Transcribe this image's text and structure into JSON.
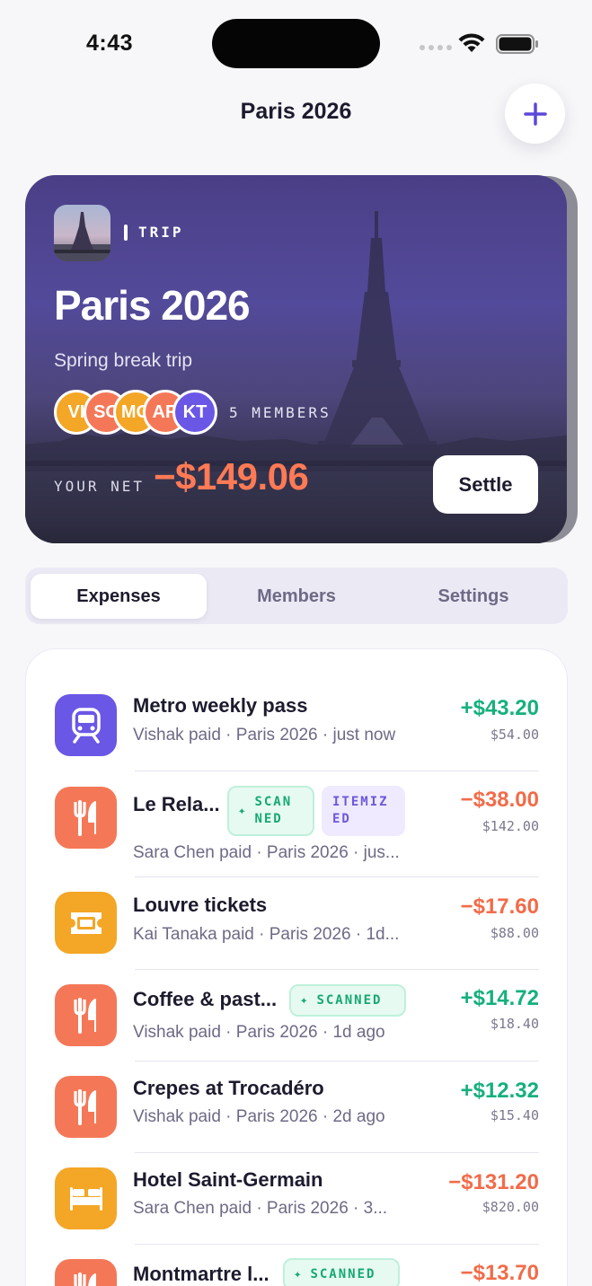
{
  "status_bar": {
    "time": "4:43"
  },
  "nav": {
    "title": "Paris 2026"
  },
  "hero": {
    "kind_label": "TRIP",
    "title": "Paris 2026",
    "subtitle": "Spring break trip",
    "avatars": [
      {
        "initials": "VI",
        "color": "#f4a626"
      },
      {
        "initials": "SC",
        "color": "#f47858"
      },
      {
        "initials": "MO",
        "color": "#f4a626"
      },
      {
        "initials": "AR",
        "color": "#f47858"
      },
      {
        "initials": "KT",
        "color": "#6a57e6"
      }
    ],
    "members_label": "5 MEMBERS",
    "net_label": "YOUR NET",
    "net_value": "−$149.06",
    "settle_label": "Settle"
  },
  "tabs": [
    {
      "label": "Expenses",
      "active": true
    },
    {
      "label": "Members",
      "active": false
    },
    {
      "label": "Settings",
      "active": false
    }
  ],
  "expenses": [
    {
      "icon": "train-icon",
      "icon_color": "#6a57e6",
      "title": "Metro weekly pass",
      "meta": "Vishak paid · Paris 2026 · just now",
      "amount": "+$43.20",
      "direction": "pos",
      "total": "$54.00",
      "badges": []
    },
    {
      "icon": "fork-knife-icon",
      "icon_color": "#f47858",
      "title": "Le Rela...",
      "meta": "Sara Chen paid · Paris 2026 · jus...",
      "amount": "−$38.00",
      "direction": "neg",
      "total": "$142.00",
      "badges": [
        "SCANNED",
        "ITEMIZED"
      ]
    },
    {
      "icon": "ticket-icon",
      "icon_color": "#f4a626",
      "title": "Louvre tickets",
      "meta": "Kai Tanaka paid · Paris 2026 · 1d...",
      "amount": "−$17.60",
      "direction": "neg",
      "total": "$88.00",
      "badges": []
    },
    {
      "icon": "fork-knife-icon",
      "icon_color": "#f47858",
      "title": "Coffee & past...",
      "meta": "Vishak paid · Paris 2026 · 1d ago",
      "amount": "+$14.72",
      "direction": "pos",
      "total": "$18.40",
      "badges": [
        "SCANNED"
      ]
    },
    {
      "icon": "fork-knife-icon",
      "icon_color": "#f47858",
      "title": "Crepes at Trocadéro",
      "meta": "Vishak paid · Paris 2026 · 2d ago",
      "amount": "+$12.32",
      "direction": "pos",
      "total": "$15.40",
      "badges": []
    },
    {
      "icon": "bed-icon",
      "icon_color": "#f4a626",
      "title": "Hotel Saint-Germain",
      "meta": "Sara Chen paid · Paris 2026 · 3...",
      "amount": "−$131.20",
      "direction": "neg",
      "total": "$820.00",
      "badges": []
    },
    {
      "icon": "fork-knife-icon",
      "icon_color": "#f47858",
      "title": "Montmartre l...",
      "meta": "",
      "amount": "−$13.70",
      "direction": "neg",
      "total": "",
      "badges": [
        "SCANNED"
      ]
    }
  ],
  "badge_text": {
    "scanned": "SCAN NED",
    "scanned_wide": "SCANNED",
    "itemized": "ITEMIZ ED"
  },
  "colors": {
    "accent": "#6a57e6",
    "positive": "#16b07c",
    "negative": "#f26b49"
  }
}
